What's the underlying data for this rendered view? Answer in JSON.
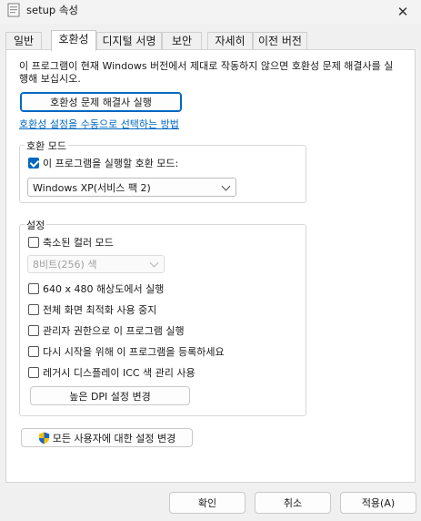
{
  "window": {
    "title": "setup 속성",
    "close_glyph": "✕"
  },
  "tabs": [
    {
      "label": "일반"
    },
    {
      "label": "호환성"
    },
    {
      "label": "디지털 서명"
    },
    {
      "label": "보안"
    },
    {
      "label": "자세히"
    },
    {
      "label": "이전 버전"
    }
  ],
  "compat": {
    "intro": "이 프로그램이 현재 Windows 버전에서 제대로 작동하지 않으면 호환성 문제 해결사를 실행해 보십시오.",
    "troubleshooter_button": "호환성 문제 해결사 실행",
    "manual_link": "호환성 설정을 수동으로 선택하는 방법",
    "mode_group": {
      "title": "호환 모드",
      "checkbox_label": "이 프로그램을 실행할 호환 모드:",
      "checked": true,
      "selected_os": "Windows XP(서비스 팩 2)"
    },
    "settings_group": {
      "title": "설정",
      "reduced_color_label": "축소된 컬러 모드",
      "color_select_value": "8비트(256) 색",
      "res_640_label": "640 x 480 해상도에서 실행",
      "fullscreen_opt_label": "전체 화면 최적화 사용 중지",
      "admin_label": "관리자 권한으로 이 프로그램 실행",
      "restart_register_label": "다시 시작을 위해 이 프로그램을 등록하세요",
      "legacy_icc_label": "레거시 디스플레이 ICC 색 관리 사용",
      "high_dpi_button": "높은 DPI 설정 변경"
    },
    "all_users_button": "모든 사용자에 대한 설정 변경"
  },
  "buttons": {
    "ok": "확인",
    "cancel": "취소",
    "apply": "적용(A)"
  },
  "colors": {
    "accent": "#0067c0"
  },
  "icons": [
    "app-icon",
    "close-icon",
    "checkbox-check-icon",
    "chevron-down-icon",
    "uac-shield-icon"
  ]
}
